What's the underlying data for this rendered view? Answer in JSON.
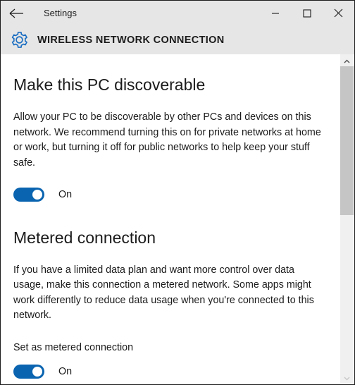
{
  "window": {
    "title": "Settings",
    "back_label": "Back",
    "border_color": "#1b1b1b",
    "titlebar_color": "#e6e6e6"
  },
  "caption_buttons": [
    {
      "name": "minimize",
      "glyph": "minimize-icon"
    },
    {
      "name": "maximize",
      "glyph": "maximize-icon"
    },
    {
      "name": "close",
      "glyph": "close-icon"
    }
  ],
  "app_header": {
    "icon": "gear-icon",
    "icon_color": "#1b6ec2",
    "title": "WIRELESS NETWORK CONNECTION"
  },
  "sections": [
    {
      "heading": "Make this PC discoverable",
      "body": "Allow your PC to be discoverable by other PCs and devices on this network. We recommend turning this on for private networks at home or work, but turning it off for public networks to help keep your stuff safe.",
      "toggle": {
        "state": "on",
        "label": "On",
        "accent": "#0a64b0"
      }
    },
    {
      "heading": "Metered connection",
      "body": "If you have a limited data plan and want more control over data usage, make this connection a metered network. Some apps might work differently to reduce data usage when you're connected to this network.",
      "field_label": "Set as metered connection",
      "toggle": {
        "state": "on",
        "label": "On",
        "accent": "#0a64b0"
      }
    }
  ],
  "scrollbar": {
    "up_arrow": "chevron-up-icon",
    "down_arrow": "chevron-down-icon",
    "thumb": "scroll-thumb"
  }
}
